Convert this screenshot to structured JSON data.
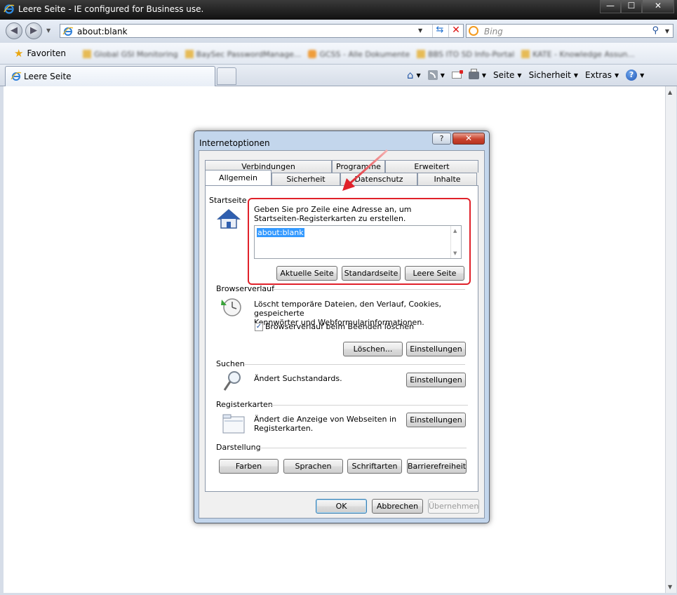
{
  "window": {
    "title": "Leere Seite - IE configured for Business use.",
    "min_glyph": "—",
    "max_glyph": "☐",
    "close_glyph": "✕"
  },
  "addressbar": {
    "url": "about:blank",
    "search_placeholder": "Bing"
  },
  "favorites": {
    "label": "Favoriten",
    "links": [
      "Global GSI Monitoring",
      "BaySec PasswordManage...",
      "GCSS - Alle Dokumente",
      "BBS ITO SD Info-Portal",
      "KATE - Knowledge Assun..."
    ]
  },
  "tab": {
    "label": "Leere Seite"
  },
  "commandbar": {
    "page": "Seite",
    "safety": "Sicherheit",
    "tools": "Extras"
  },
  "dialog": {
    "title": "Internetoptionen",
    "help_glyph": "?",
    "close_glyph": "✕",
    "tabs_top": [
      "Verbindungen",
      "Programme",
      "Erweitert"
    ],
    "tabs_bottom": [
      "Allgemein",
      "Sicherheit",
      "Datenschutz",
      "Inhalte"
    ],
    "homepage": {
      "label": "Startseite",
      "desc_line1": "Geben Sie pro Zeile eine Adresse an, um",
      "desc_line2": "Startseiten-Registerkarten zu erstellen.",
      "value": "about:blank",
      "btn_current": "Aktuelle Seite",
      "btn_default": "Standardseite",
      "btn_blank": "Leere Seite"
    },
    "history": {
      "label": "Browserverlauf",
      "desc_line1": "Löscht temporäre Dateien, den Verlauf, Cookies, gespeicherte",
      "desc_line2": "Kennwörter und Webformularinformationen.",
      "checkbox_label": "Browserverlauf beim Beenden löschen",
      "checked": true,
      "btn_delete": "Löschen...",
      "btn_settings": "Einstellungen"
    },
    "search": {
      "label": "Suchen",
      "desc": "Ändert Suchstandards.",
      "btn_settings": "Einstellungen"
    },
    "tabs_section": {
      "label": "Registerkarten",
      "desc_line1": "Ändert die Anzeige von Webseiten in",
      "desc_line2": "Registerkarten.",
      "btn_settings": "Einstellungen"
    },
    "appearance": {
      "label": "Darstellung",
      "btn_colors": "Farben",
      "btn_languages": "Sprachen",
      "btn_fonts": "Schriftarten",
      "btn_accessibility": "Barrierefreiheit"
    },
    "footer": {
      "ok": "OK",
      "cancel": "Abbrechen",
      "apply": "Übernehmen"
    }
  },
  "colors": {
    "highlight": "#e0212a",
    "selection": "#3399ff"
  }
}
